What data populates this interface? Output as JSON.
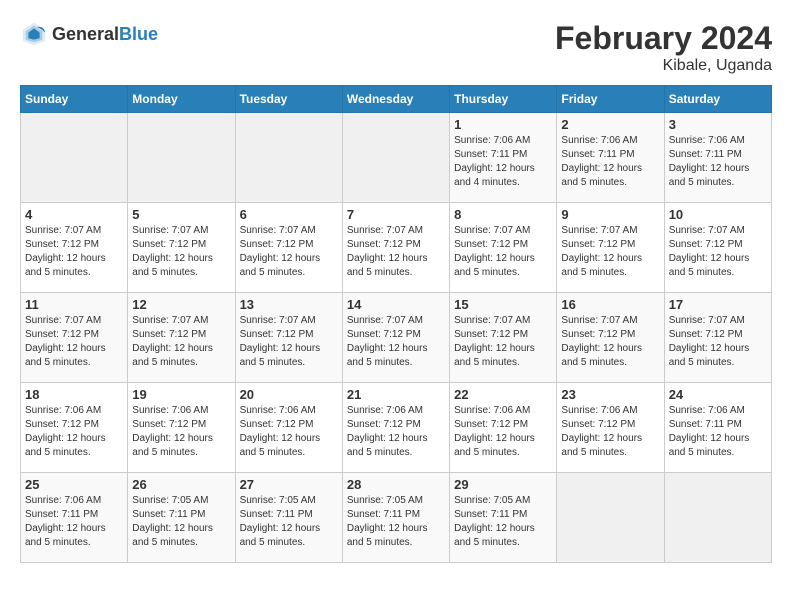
{
  "header": {
    "logo": {
      "general": "General",
      "blue": "Blue"
    },
    "title": "February 2024",
    "location": "Kibale, Uganda"
  },
  "calendar": {
    "weekdays": [
      "Sunday",
      "Monday",
      "Tuesday",
      "Wednesday",
      "Thursday",
      "Friday",
      "Saturday"
    ],
    "weeks": [
      [
        {
          "day": "",
          "info": ""
        },
        {
          "day": "",
          "info": ""
        },
        {
          "day": "",
          "info": ""
        },
        {
          "day": "",
          "info": ""
        },
        {
          "day": "1",
          "info": "Sunrise: 7:06 AM\nSunset: 7:11 PM\nDaylight: 12 hours\nand 4 minutes."
        },
        {
          "day": "2",
          "info": "Sunrise: 7:06 AM\nSunset: 7:11 PM\nDaylight: 12 hours\nand 5 minutes."
        },
        {
          "day": "3",
          "info": "Sunrise: 7:06 AM\nSunset: 7:11 PM\nDaylight: 12 hours\nand 5 minutes."
        }
      ],
      [
        {
          "day": "4",
          "info": "Sunrise: 7:07 AM\nSunset: 7:12 PM\nDaylight: 12 hours\nand 5 minutes."
        },
        {
          "day": "5",
          "info": "Sunrise: 7:07 AM\nSunset: 7:12 PM\nDaylight: 12 hours\nand 5 minutes."
        },
        {
          "day": "6",
          "info": "Sunrise: 7:07 AM\nSunset: 7:12 PM\nDaylight: 12 hours\nand 5 minutes."
        },
        {
          "day": "7",
          "info": "Sunrise: 7:07 AM\nSunset: 7:12 PM\nDaylight: 12 hours\nand 5 minutes."
        },
        {
          "day": "8",
          "info": "Sunrise: 7:07 AM\nSunset: 7:12 PM\nDaylight: 12 hours\nand 5 minutes."
        },
        {
          "day": "9",
          "info": "Sunrise: 7:07 AM\nSunset: 7:12 PM\nDaylight: 12 hours\nand 5 minutes."
        },
        {
          "day": "10",
          "info": "Sunrise: 7:07 AM\nSunset: 7:12 PM\nDaylight: 12 hours\nand 5 minutes."
        }
      ],
      [
        {
          "day": "11",
          "info": "Sunrise: 7:07 AM\nSunset: 7:12 PM\nDaylight: 12 hours\nand 5 minutes."
        },
        {
          "day": "12",
          "info": "Sunrise: 7:07 AM\nSunset: 7:12 PM\nDaylight: 12 hours\nand 5 minutes."
        },
        {
          "day": "13",
          "info": "Sunrise: 7:07 AM\nSunset: 7:12 PM\nDaylight: 12 hours\nand 5 minutes."
        },
        {
          "day": "14",
          "info": "Sunrise: 7:07 AM\nSunset: 7:12 PM\nDaylight: 12 hours\nand 5 minutes."
        },
        {
          "day": "15",
          "info": "Sunrise: 7:07 AM\nSunset: 7:12 PM\nDaylight: 12 hours\nand 5 minutes."
        },
        {
          "day": "16",
          "info": "Sunrise: 7:07 AM\nSunset: 7:12 PM\nDaylight: 12 hours\nand 5 minutes."
        },
        {
          "day": "17",
          "info": "Sunrise: 7:07 AM\nSunset: 7:12 PM\nDaylight: 12 hours\nand 5 minutes."
        }
      ],
      [
        {
          "day": "18",
          "info": "Sunrise: 7:06 AM\nSunset: 7:12 PM\nDaylight: 12 hours\nand 5 minutes."
        },
        {
          "day": "19",
          "info": "Sunrise: 7:06 AM\nSunset: 7:12 PM\nDaylight: 12 hours\nand 5 minutes."
        },
        {
          "day": "20",
          "info": "Sunrise: 7:06 AM\nSunset: 7:12 PM\nDaylight: 12 hours\nand 5 minutes."
        },
        {
          "day": "21",
          "info": "Sunrise: 7:06 AM\nSunset: 7:12 PM\nDaylight: 12 hours\nand 5 minutes."
        },
        {
          "day": "22",
          "info": "Sunrise: 7:06 AM\nSunset: 7:12 PM\nDaylight: 12 hours\nand 5 minutes."
        },
        {
          "day": "23",
          "info": "Sunrise: 7:06 AM\nSunset: 7:12 PM\nDaylight: 12 hours\nand 5 minutes."
        },
        {
          "day": "24",
          "info": "Sunrise: 7:06 AM\nSunset: 7:11 PM\nDaylight: 12 hours\nand 5 minutes."
        }
      ],
      [
        {
          "day": "25",
          "info": "Sunrise: 7:06 AM\nSunset: 7:11 PM\nDaylight: 12 hours\nand 5 minutes."
        },
        {
          "day": "26",
          "info": "Sunrise: 7:05 AM\nSunset: 7:11 PM\nDaylight: 12 hours\nand 5 minutes."
        },
        {
          "day": "27",
          "info": "Sunrise: 7:05 AM\nSunset: 7:11 PM\nDaylight: 12 hours\nand 5 minutes."
        },
        {
          "day": "28",
          "info": "Sunrise: 7:05 AM\nSunset: 7:11 PM\nDaylight: 12 hours\nand 5 minutes."
        },
        {
          "day": "29",
          "info": "Sunrise: 7:05 AM\nSunset: 7:11 PM\nDaylight: 12 hours\nand 5 minutes."
        },
        {
          "day": "",
          "info": ""
        },
        {
          "day": "",
          "info": ""
        }
      ]
    ]
  }
}
